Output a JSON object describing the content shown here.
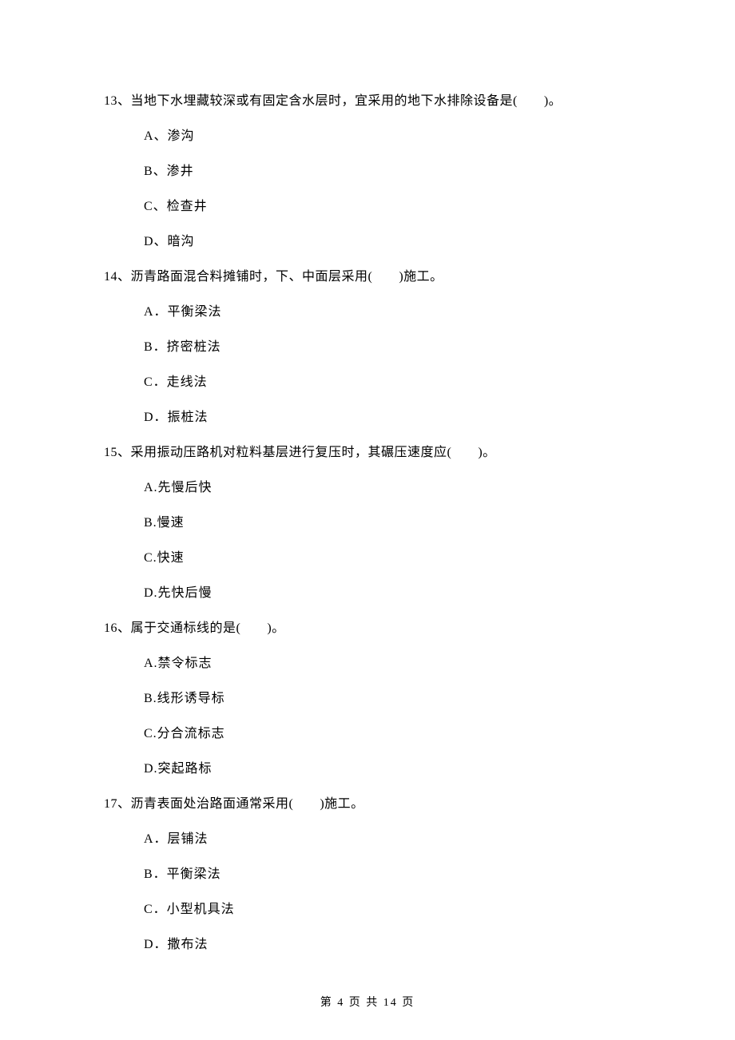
{
  "questions": [
    {
      "number": "13、",
      "text": "当地下水埋藏较深或有固定含水层时，宜采用的地下水排除设备是(　　)。",
      "options": [
        "A、渗沟",
        "B、渗井",
        "C、检查井",
        "D、暗沟"
      ]
    },
    {
      "number": "14、",
      "text": "沥青路面混合料摊铺时，下、中面层采用(　　)施工。",
      "options": [
        "A．平衡梁法",
        "B．挤密桩法",
        "C．走线法",
        "D．振桩法"
      ]
    },
    {
      "number": "15、",
      "text": "采用振动压路机对粒料基层进行复压时，其碾压速度应(　　)。",
      "options": [
        "A.先慢后快",
        "B.慢速",
        "C.快速",
        "D.先快后慢"
      ]
    },
    {
      "number": "16、",
      "text": "属于交通标线的是(　　)。",
      "options": [
        "A.禁令标志",
        "B.线形诱导标",
        "C.分合流标志",
        "D.突起路标"
      ]
    },
    {
      "number": "17、",
      "text": "沥青表面处治路面通常采用(　　)施工。",
      "options": [
        "A．层铺法",
        "B．平衡梁法",
        "C．小型机具法",
        "D．撒布法"
      ]
    }
  ],
  "footer": "第 4 页 共 14 页"
}
